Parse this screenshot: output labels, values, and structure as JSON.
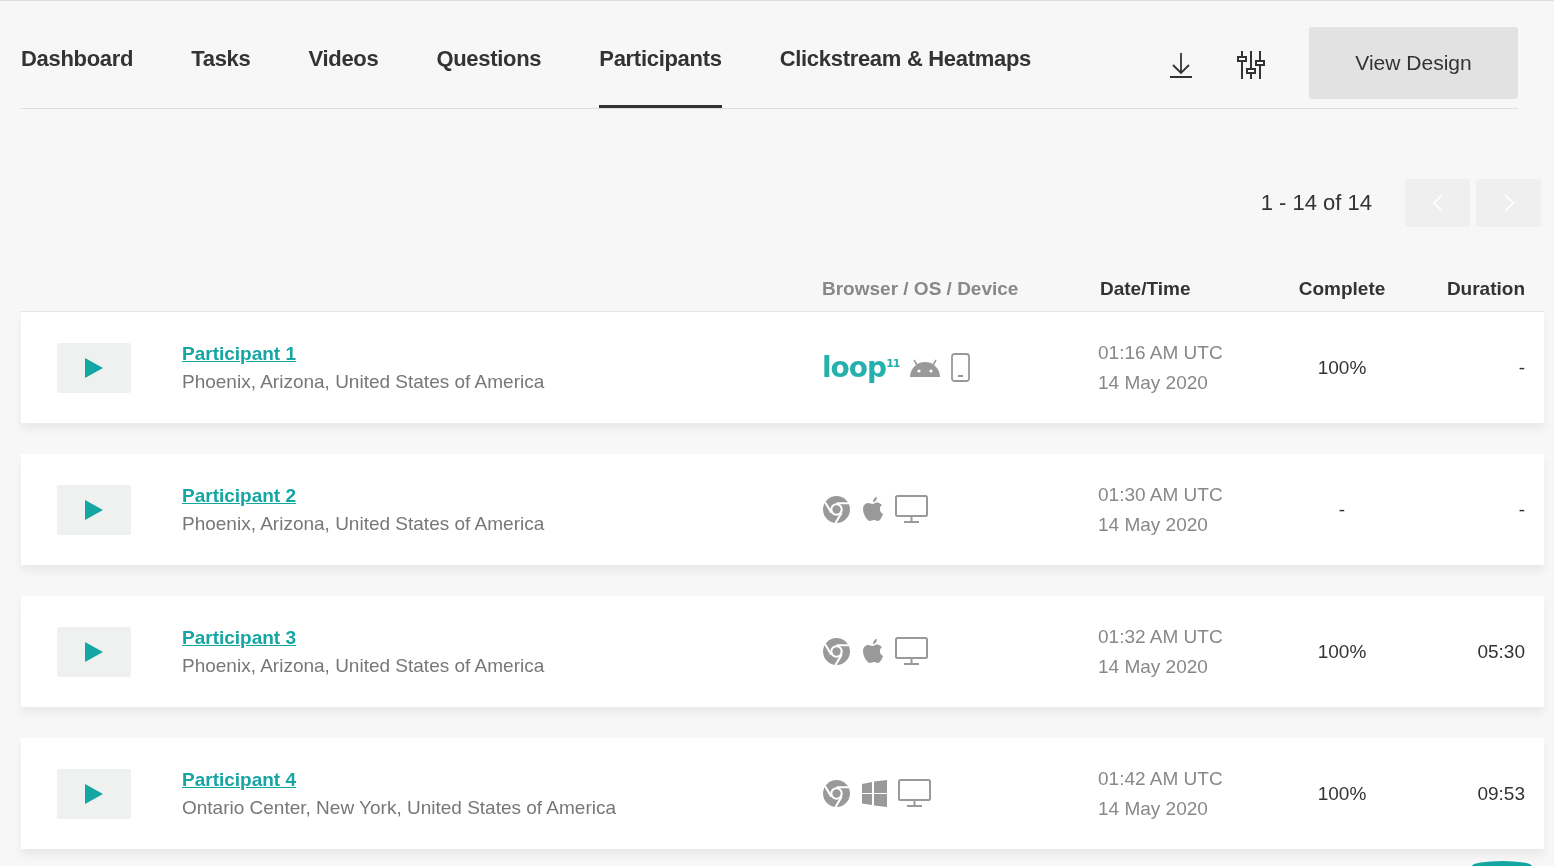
{
  "tabs": [
    {
      "label": "Dashboard",
      "selected": false
    },
    {
      "label": "Tasks",
      "selected": false
    },
    {
      "label": "Videos",
      "selected": false
    },
    {
      "label": "Questions",
      "selected": false
    },
    {
      "label": "Participants",
      "selected": true
    },
    {
      "label": "Clickstream & Heatmaps",
      "selected": false
    }
  ],
  "view_design_button": "View Design",
  "pagination": {
    "range": "1 - 14 of 14",
    "prev_disabled": true,
    "next_disabled": true
  },
  "table": {
    "columns": [
      "Browser / OS / Device",
      "Date/Time",
      "Complete",
      "Duration"
    ],
    "rows": [
      {
        "name": "Participant 1",
        "location": "Phoenix, Arizona, United States of America",
        "environment": [
          {
            "kind": "loop11",
            "label": "loop$^{11}$"
          },
          {
            "kind": "android"
          },
          {
            "kind": "mobile"
          }
        ],
        "time": "01:16 AM UTC",
        "date": "14 May 2020",
        "complete": "100%",
        "duration": "-"
      },
      {
        "name": "Participant 2",
        "location": "Phoenix, Arizona, United States of America",
        "environment": [
          {
            "kind": "chrome"
          },
          {
            "kind": "apple"
          },
          {
            "kind": "desktop"
          }
        ],
        "time": "01:30 AM UTC",
        "date": "14 May 2020",
        "complete": "-",
        "duration": "-"
      },
      {
        "name": "Participant 3",
        "location": "Phoenix, Arizona, United States of America",
        "environment": [
          {
            "kind": "chrome"
          },
          {
            "kind": "apple"
          },
          {
            "kind": "desktop"
          }
        ],
        "time": "01:32 AM UTC",
        "date": "14 May 2020",
        "complete": "100%",
        "duration": "05:30"
      },
      {
        "name": "Participant 4",
        "location": "Ontario Center, New York, United States of America",
        "environment": [
          {
            "kind": "chrome"
          },
          {
            "kind": "windows"
          },
          {
            "kind": "desktop"
          }
        ],
        "time": "01:42 AM UTC",
        "date": "14 May 2020",
        "complete": "100%",
        "duration": "09:53"
      }
    ]
  }
}
